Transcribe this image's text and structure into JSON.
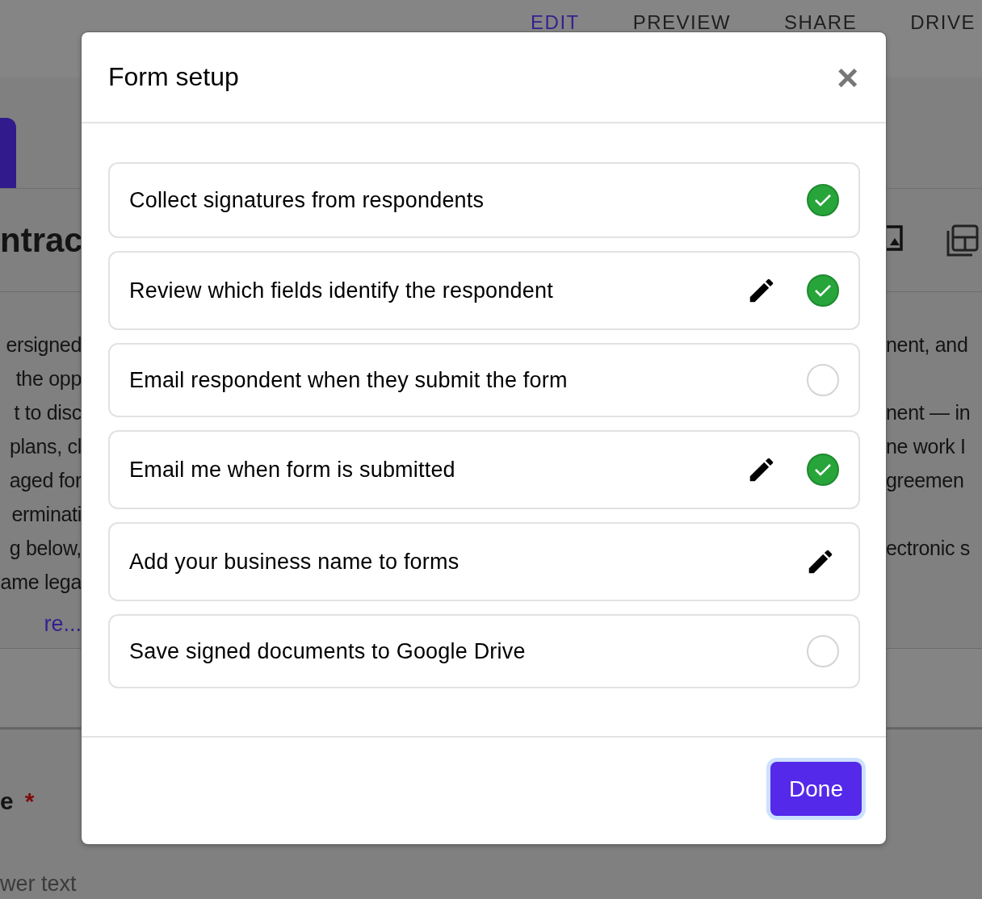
{
  "nav_tabs": [
    {
      "label": "EDIT",
      "selected": true
    },
    {
      "label": "PREVIEW",
      "selected": false
    },
    {
      "label": "SHARE",
      "selected": false
    },
    {
      "label": "DRIVE",
      "selected": false
    }
  ],
  "background": {
    "title": "ntrac",
    "lines": [
      {
        "left": "ersigned",
        "right": "nent, and"
      },
      {
        "left": "the opp"
      },
      {
        "left": "t to disc",
        "right": "nent — in"
      },
      {
        "left": "plans, cl",
        "right": "ne work I"
      },
      {
        "left": "aged for",
        "right": "greemen"
      },
      {
        "left": "erminati"
      },
      {
        "left": "g below,",
        "right": "ectronic s"
      },
      {
        "left": "ame lega"
      }
    ],
    "more_link": "re...",
    "question_label": "e",
    "required_mark": "*",
    "answer_placeholder": "wer text"
  },
  "dialog": {
    "title": "Form setup",
    "close": "×",
    "items": [
      {
        "label": "Collect signatures from respondents",
        "kind": "toggle",
        "checked": true,
        "editable": false
      },
      {
        "label": "Review which fields identify the respondent",
        "kind": "toggle",
        "checked": true,
        "editable": true
      },
      {
        "label": "Email respondent when they submit the form",
        "kind": "toggle",
        "checked": false,
        "editable": false
      },
      {
        "label": "Email me when form is submitted",
        "kind": "toggle",
        "checked": true,
        "editable": true
      },
      {
        "label": "Add your business name to forms",
        "kind": "action",
        "editable": true
      },
      {
        "label": "Save signed documents to Google Drive",
        "kind": "toggle",
        "checked": false,
        "editable": false
      }
    ],
    "done_button": "Done"
  }
}
